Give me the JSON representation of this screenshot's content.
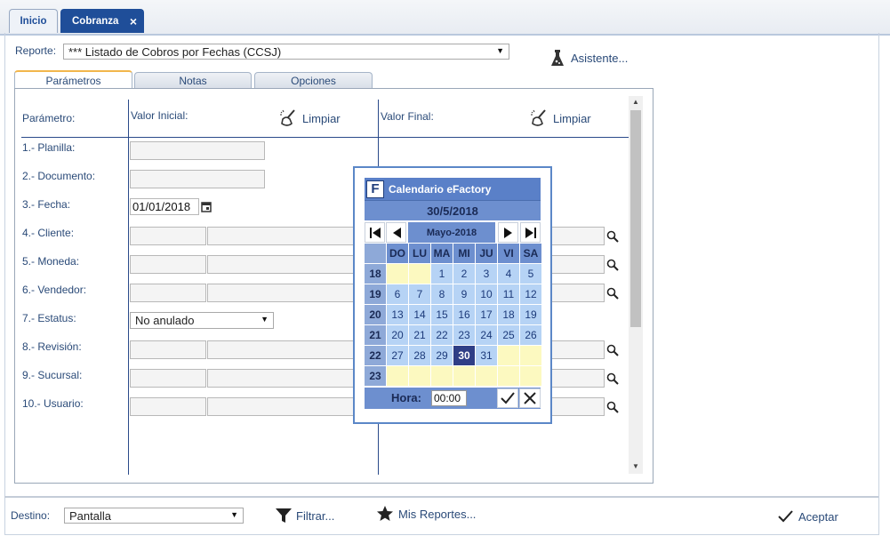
{
  "tabs": [
    {
      "label": "Inicio"
    },
    {
      "label": "Cobranza",
      "close": "×"
    }
  ],
  "reporte": {
    "label": "Reporte:",
    "value": "*** Listado de Cobros por Fechas (CCSJ)",
    "asistente": "Asistente..."
  },
  "inner_tabs": [
    "Parámetros",
    "Notas",
    "Opciones"
  ],
  "columns": {
    "param": "Parámetro:",
    "valor_inicial": "Valor Inicial:",
    "valor_final": "Valor Final:",
    "limpiar": "Limpiar"
  },
  "params": [
    {
      "label": "1.- Planilla:"
    },
    {
      "label": "2.- Documento:"
    },
    {
      "label": "3.- Fecha:",
      "value": "01/01/2018"
    },
    {
      "label": "4.- Cliente:"
    },
    {
      "label": "5.- Moneda:"
    },
    {
      "label": "6.- Vendedor:"
    },
    {
      "label": "7.- Estatus:",
      "value": "No anulado"
    },
    {
      "label": "8.- Revisión:"
    },
    {
      "label": "9.- Sucursal:"
    },
    {
      "label": "10.- Usuario:"
    }
  ],
  "calendar": {
    "title": "Calendario eFactory",
    "logo": "F",
    "selected_date": "30/5/2018",
    "month": "Mayo-2018",
    "day_headers": [
      "DO",
      "LU",
      "MA",
      "MI",
      "JU",
      "VI",
      "SA"
    ],
    "weeks": [
      {
        "num": "18",
        "days": [
          "",
          "",
          "1",
          "2",
          "3",
          "4",
          "5"
        ]
      },
      {
        "num": "19",
        "days": [
          "6",
          "7",
          "8",
          "9",
          "10",
          "11",
          "12"
        ]
      },
      {
        "num": "20",
        "days": [
          "13",
          "14",
          "15",
          "16",
          "17",
          "18",
          "19"
        ]
      },
      {
        "num": "21",
        "days": [
          "20",
          "21",
          "22",
          "23",
          "24",
          "25",
          "26"
        ]
      },
      {
        "num": "22",
        "days": [
          "27",
          "28",
          "29",
          "30",
          "31",
          "",
          ""
        ]
      },
      {
        "num": "23",
        "days": [
          "",
          "",
          "",
          "",
          "",
          "",
          ""
        ]
      }
    ],
    "selected_day": "30",
    "hora_label": "Hora:",
    "hora_value": "00:00"
  },
  "bottom": {
    "destino_label": "Destino:",
    "destino_value": "Pantalla",
    "filtrar": "Filtrar...",
    "mis_reportes": "Mis Reportes...",
    "aceptar": "Aceptar"
  },
  "colors": {
    "accent": "#2a4a78",
    "active_tab": "#1f4e99",
    "calendar_header": "#5a80c8",
    "calendar_day": "#b6d3f5",
    "calendar_empty": "#fcf9c0",
    "calendar_selected": "#2f3e86"
  }
}
